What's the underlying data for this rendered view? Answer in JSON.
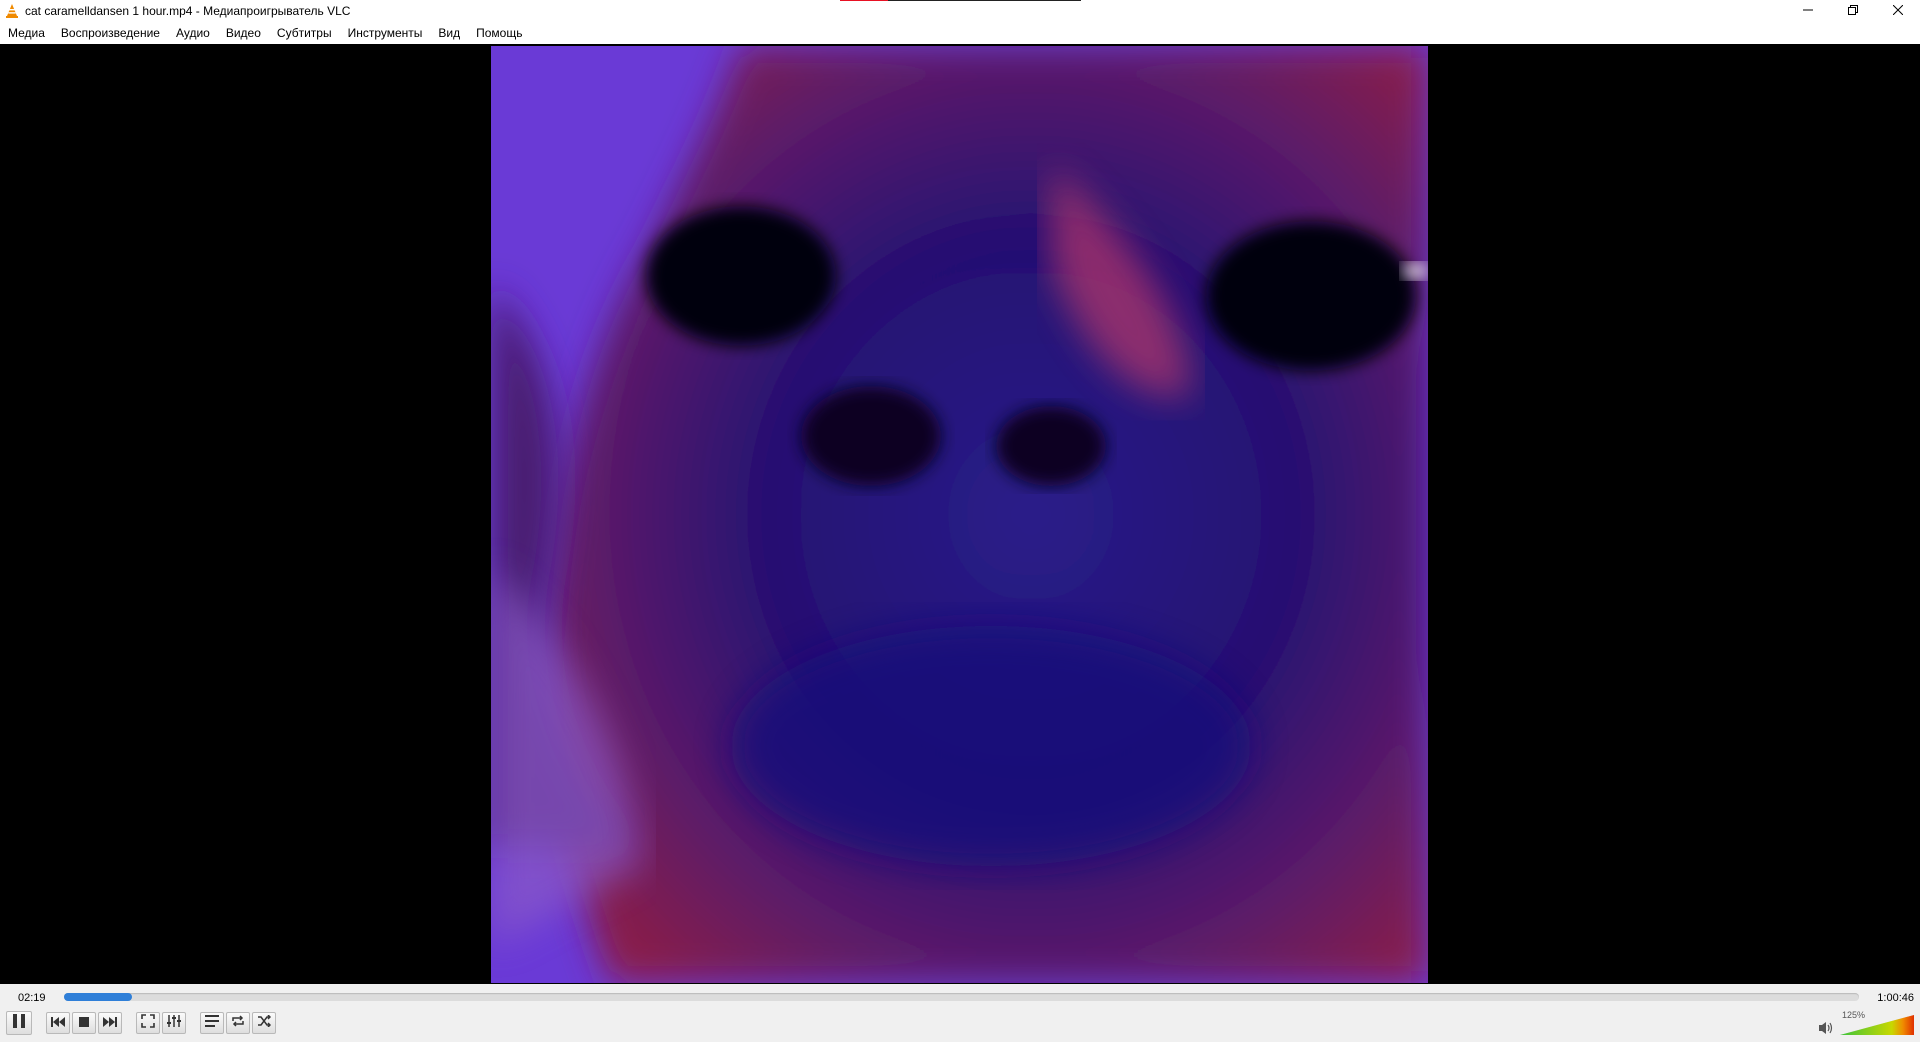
{
  "window": {
    "title": "cat caramelldansen 1 hour.mp4 - Медиапроигрыватель VLC",
    "icon": "vlc-cone-icon"
  },
  "window_controls": {
    "minimize_icon": "minimize-icon",
    "restore_icon": "restore-icon",
    "close_icon": "close-icon"
  },
  "menu": {
    "items": [
      {
        "label": "Медиа"
      },
      {
        "label": "Воспроизведение"
      },
      {
        "label": "Аудио"
      },
      {
        "label": "Видео"
      },
      {
        "label": "Субтитры"
      },
      {
        "label": "Инструменты"
      },
      {
        "label": "Вид"
      },
      {
        "label": "Помощь"
      }
    ]
  },
  "playback": {
    "current_time": "02:19",
    "total_time": "1:00:46",
    "progress_fraction": 0.038
  },
  "controls": {
    "buttons": [
      "pause-icon",
      "previous-icon",
      "stop-icon",
      "next-icon",
      "fullscreen-icon",
      "extended-settings-icon",
      "playlist-icon",
      "loop-icon",
      "shuffle-icon"
    ]
  },
  "volume": {
    "label": "125%",
    "level_percent": 125,
    "icon": "speaker-icon"
  },
  "colors": {
    "accent": "#2f7fd8",
    "video_background": "#000000"
  }
}
